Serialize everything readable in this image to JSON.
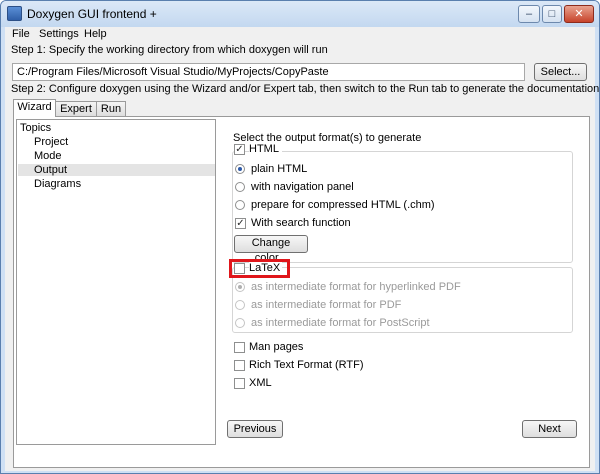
{
  "window": {
    "title": "Doxygen GUI frontend +",
    "controls": {
      "minimize": "–",
      "maximize": "□",
      "close": "✕"
    }
  },
  "menu": [
    "File",
    "Settings",
    "Help"
  ],
  "step1": {
    "label": "Step 1: Specify the working directory from which doxygen will run",
    "path_value": "C:/Program Files/Microsoft Visual Studio/MyProjects/CopyPaste",
    "select_button": "Select..."
  },
  "step2": {
    "label": "Step 2: Configure doxygen using the Wizard and/or Expert tab, then switch to the Run tab to generate the documentation"
  },
  "tabs": [
    {
      "label": "Wizard",
      "active": true
    },
    {
      "label": "Expert",
      "active": false
    },
    {
      "label": "Run",
      "active": false
    }
  ],
  "topics": {
    "header": "Topics",
    "items": [
      "Project",
      "Mode",
      "Output",
      "Diagrams"
    ],
    "selected": "Output"
  },
  "output": {
    "section_title": "Select the output format(s) to generate",
    "html": {
      "label": "HTML",
      "checked": true,
      "options": [
        {
          "label": "plain HTML",
          "selected": true
        },
        {
          "label": "with navigation panel",
          "selected": false
        },
        {
          "label": "prepare for compressed HTML (.chm)",
          "selected": false
        }
      ],
      "search": {
        "label": "With search function",
        "checked": true
      },
      "change_color_button": "Change color..."
    },
    "latex": {
      "label": "LaTeX",
      "checked": false,
      "options": [
        {
          "label": "as intermediate format for hyperlinked PDF",
          "selected": true
        },
        {
          "label": "as intermediate format for PDF",
          "selected": false
        },
        {
          "label": "as intermediate format for PostScript",
          "selected": false
        }
      ]
    },
    "others": [
      {
        "label": "Man pages",
        "checked": false
      },
      {
        "label": "Rich Text Format (RTF)",
        "checked": false
      },
      {
        "label": "XML",
        "checked": false
      }
    ]
  },
  "nav": {
    "previous": "Previous",
    "next": "Next"
  },
  "colors": {
    "highlight": "#e0161b",
    "accent": "#2d5aa8",
    "titlebar": "#c3d8f0"
  }
}
